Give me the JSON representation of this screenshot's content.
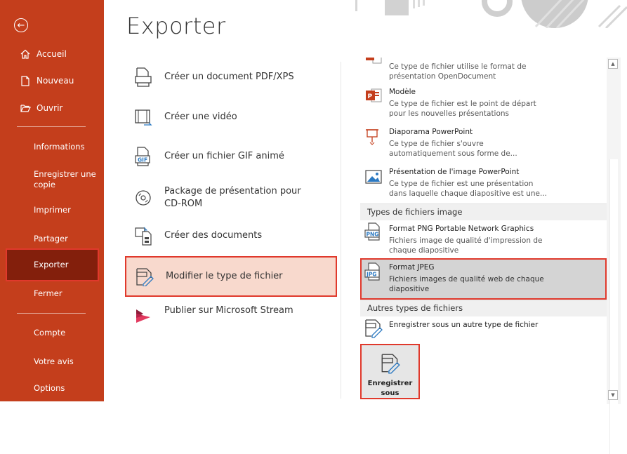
{
  "sidebar": {
    "top": [
      {
        "label": "Accueil",
        "icon": "home-icon"
      },
      {
        "label": "Nouveau",
        "icon": "new-file-icon"
      },
      {
        "label": "Ouvrir",
        "icon": "folder-icon"
      }
    ],
    "items": {
      "informations": "Informations",
      "save_copy_1": "Enregistrer une",
      "save_copy_2": "copie",
      "print": "Imprimer",
      "share": "Partager",
      "export": "Exporter",
      "close": "Fermer",
      "account": "Compte",
      "feedback": "Votre avis",
      "options": "Options"
    },
    "selected": "Exporter",
    "color": "#c43e1c",
    "selected_color": "#831f0c"
  },
  "main": {
    "title": "Exporter",
    "options": [
      {
        "label": "Créer un document PDF/XPS",
        "icon": "pdf-document-icon"
      },
      {
        "label": "Créer une vidéo",
        "icon": "video-icon"
      },
      {
        "label": "Créer un fichier GIF animé",
        "icon": "gif-file-icon"
      },
      {
        "label_1": "Package de présentation pour",
        "label_2": "CD-ROM",
        "icon": "cd-rom-icon"
      },
      {
        "label": "Créer des documents",
        "icon": "handouts-icon"
      },
      {
        "label": "Modifier le type de fichier",
        "icon": "change-file-type-icon"
      },
      {
        "label": "Publier sur Microsoft Stream",
        "icon": "stream-icon"
      }
    ],
    "selected_option": "Modifier le type de fichier"
  },
  "filetypes": {
    "odp": {
      "desc_1": "Ce type de fichier utilise le format de",
      "desc_2": "présentation OpenDocument"
    },
    "template": {
      "name": "Modèle",
      "desc_1": "Ce type de fichier est le point de départ",
      "desc_2": "pour les nouvelles présentations"
    },
    "show": {
      "name": "Diaporama PowerPoint",
      "desc_1": "Ce type de fichier s'ouvre",
      "desc_2": "automatiquement sous forme de..."
    },
    "picture": {
      "name": "Présentation de l'image PowerPoint",
      "desc_1": "Ce type de fichier est une présentation",
      "desc_2": "dans laquelle chaque diapositive est une..."
    },
    "cat_image": "Types de fichiers image",
    "png": {
      "name": "Format PNG Portable Network Graphics",
      "desc_1": "Fichiers image de qualité d'impression de",
      "desc_2": "chaque diapositive",
      "badge": "PNG"
    },
    "jpeg": {
      "name": "Format JPEG",
      "desc_1": "Fichiers images de qualité web de chaque",
      "desc_2": "diapositive",
      "badge": "JPG"
    },
    "cat_other": "Autres types de fichiers",
    "other": {
      "name": "Enregistrer sous un autre type de fichier"
    },
    "selected": "Format JPEG"
  },
  "save_button": {
    "line_1": "Enregistrer",
    "line_2": "sous"
  },
  "colors": {
    "accent": "#c43e1c",
    "highlight_border": "#e0392c",
    "selected_option_bg": "#f8d9cd"
  }
}
